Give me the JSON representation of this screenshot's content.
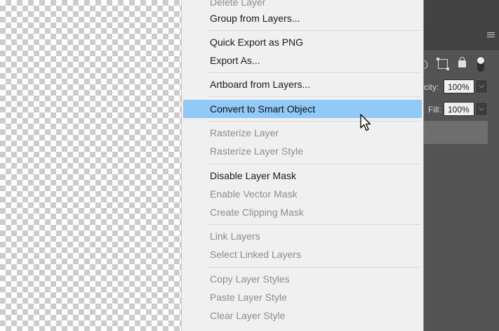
{
  "context_menu": {
    "items": [
      {
        "label": "Delete Layer",
        "enabled": false
      },
      {
        "label": "Group from Layers...",
        "enabled": true
      },
      {
        "label": "Quick Export as PNG",
        "enabled": true
      },
      {
        "label": "Export As...",
        "enabled": true
      },
      {
        "label": "Artboard from Layers...",
        "enabled": true
      },
      {
        "label": "Convert to Smart Object",
        "enabled": true,
        "highlighted": true
      },
      {
        "label": "Rasterize Layer",
        "enabled": false
      },
      {
        "label": "Rasterize Layer Style",
        "enabled": false
      },
      {
        "label": "Disable Layer Mask",
        "enabled": true
      },
      {
        "label": "Enable Vector Mask",
        "enabled": false
      },
      {
        "label": "Create Clipping Mask",
        "enabled": false
      },
      {
        "label": "Link Layers",
        "enabled": false
      },
      {
        "label": "Select Linked Layers",
        "enabled": false
      },
      {
        "label": "Copy Layer Styles",
        "enabled": false
      },
      {
        "label": "Paste Layer Style",
        "enabled": false
      },
      {
        "label": "Clear Layer Style",
        "enabled": false
      }
    ],
    "highlight_color": "#91c9f7"
  },
  "layers_panel": {
    "opacity_label": "city:",
    "opacity_value": "100%",
    "fill_label": "Fill:",
    "fill_value": "100%",
    "dropdown_glyph": "⌵",
    "icons": [
      "transform-lock-icon",
      "padlock-icon",
      "toggle-icon",
      "panel-menu-icon"
    ]
  },
  "colors": {
    "canvas_checker_dark": "#cccccc",
    "canvas_checker_light": "#ffffff",
    "panel_bg": "#535353",
    "menu_bg": "#f0f0f0"
  }
}
